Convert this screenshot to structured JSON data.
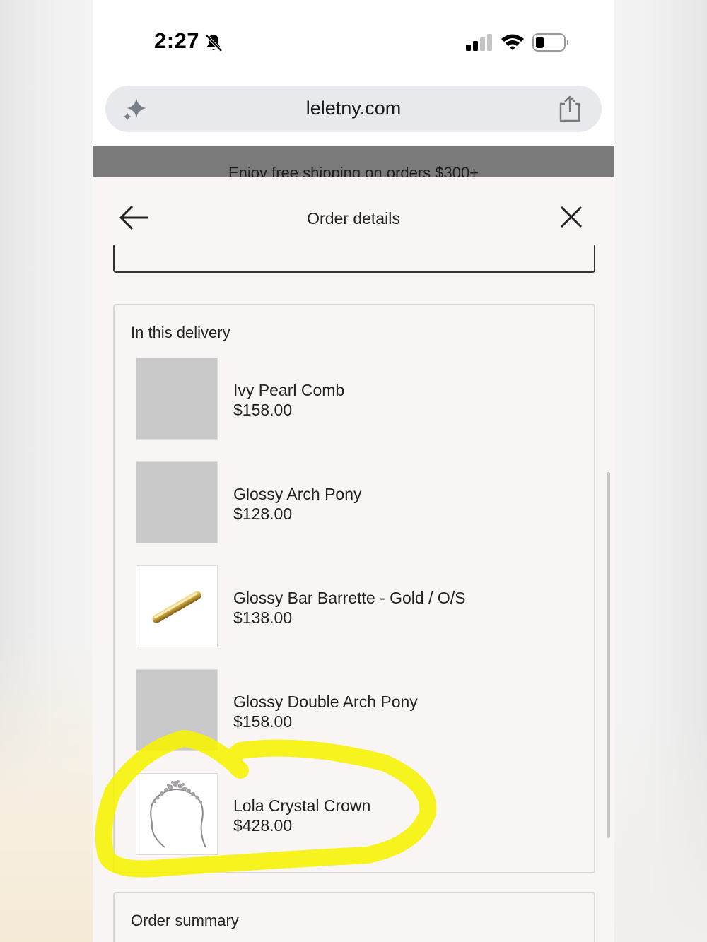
{
  "status_bar": {
    "time": "2:27",
    "icons": [
      "bell-slash-icon",
      "cellular-signal-icon",
      "wifi-icon",
      "battery-icon"
    ]
  },
  "browser": {
    "url": "leletny.com",
    "icons": [
      "sparkle-icon",
      "share-icon"
    ]
  },
  "promo": {
    "text": "Enjoy free shipping on orders $300+"
  },
  "sheet": {
    "title": "Order details",
    "back_icon": "arrow-left-icon",
    "close_icon": "close-icon"
  },
  "delivery": {
    "title": "In this delivery",
    "items": [
      {
        "name": "Ivy Pearl Comb",
        "price": "$158.00",
        "image": "placeholder"
      },
      {
        "name": "Glossy Arch Pony",
        "price": "$128.00",
        "image": "placeholder"
      },
      {
        "name": "Glossy Bar Barrette - Gold / O/S",
        "price": "$138.00",
        "image": "gold-barrette"
      },
      {
        "name": "Glossy Double Arch Pony",
        "price": "$158.00",
        "image": "placeholder"
      },
      {
        "name": "Lola Crystal Crown",
        "price": "$428.00",
        "image": "crystal-crown"
      }
    ]
  },
  "summary": {
    "title": "Order summary"
  },
  "colors": {
    "highlight": "#f6f200",
    "sheet_bg": "#f9f5f4",
    "promo_bg": "#7a7a7a",
    "placeholder": "#c9c9c9"
  }
}
